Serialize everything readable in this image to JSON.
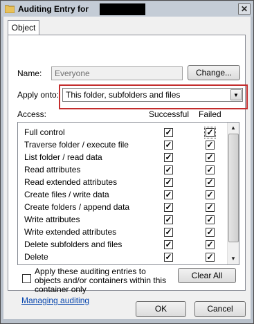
{
  "window": {
    "title": "Auditing Entry for",
    "close_glyph": "✕"
  },
  "tab": {
    "label": "Object"
  },
  "name_row": {
    "label": "Name:",
    "value": "Everyone",
    "change_button": "Change..."
  },
  "apply_row": {
    "label": "Apply onto:",
    "selected": "This folder, subfolders and files",
    "arrow_glyph": "▼"
  },
  "list": {
    "access_header": "Access:",
    "successful_header": "Successful",
    "failed_header": "Failed",
    "check_glyph": "✓",
    "rows": [
      {
        "permission": "Full control",
        "successful": true,
        "failed": true
      },
      {
        "permission": "Traverse folder / execute file",
        "successful": true,
        "failed": true
      },
      {
        "permission": "List folder / read data",
        "successful": true,
        "failed": true
      },
      {
        "permission": "Read attributes",
        "successful": true,
        "failed": true
      },
      {
        "permission": "Read extended attributes",
        "successful": true,
        "failed": true
      },
      {
        "permission": "Create files / write data",
        "successful": true,
        "failed": true
      },
      {
        "permission": "Create folders / append data",
        "successful": true,
        "failed": true
      },
      {
        "permission": "Write attributes",
        "successful": true,
        "failed": true
      },
      {
        "permission": "Write extended attributes",
        "successful": true,
        "failed": true
      },
      {
        "permission": "Delete subfolders and files",
        "successful": true,
        "failed": true
      },
      {
        "permission": "Delete",
        "successful": true,
        "failed": true
      }
    ]
  },
  "apply_inherit": {
    "label": "Apply these auditing entries to objects and/or containers within this container only",
    "checked": false
  },
  "clear_all_button": "Clear All",
  "help_link": "Managing auditing",
  "footer": {
    "ok": "OK",
    "cancel": "Cancel"
  },
  "colors": {
    "highlight_border": "#c42d2d",
    "link": "#0645ad"
  }
}
